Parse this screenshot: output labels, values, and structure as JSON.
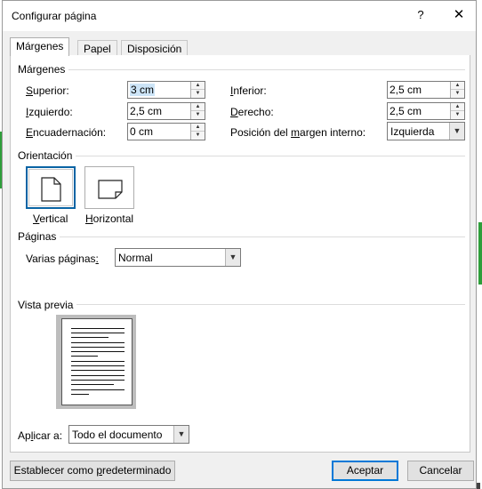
{
  "window": {
    "title": "Configurar página",
    "help_label": "?",
    "close_label": "✕"
  },
  "tabs": [
    {
      "label": "Márgenes",
      "active": true
    },
    {
      "label": "Papel",
      "active": false
    },
    {
      "label": "Disposición",
      "active": false
    }
  ],
  "margins": {
    "group_label": "Márgenes",
    "superior": {
      "label_pre": "",
      "label_u": "S",
      "label_post": "uperior:",
      "value": "3 cm"
    },
    "inferior": {
      "label_pre": "",
      "label_u": "I",
      "label_post": "nferior:",
      "value": "2,5 cm"
    },
    "izquierdo": {
      "label_pre": "",
      "label_u": "I",
      "label_post": "zquierdo:",
      "value": "2,5 cm"
    },
    "derecho": {
      "label_pre": "",
      "label_u": "D",
      "label_post": "erecho:",
      "value": "2,5 cm"
    },
    "encuadernacion": {
      "label_pre": "",
      "label_u": "E",
      "label_post": "ncuadernación:",
      "value": "0 cm"
    },
    "posicion": {
      "label_pre": "Posición del ",
      "label_u": "m",
      "label_post": "argen interno:",
      "value": "Izquierda"
    }
  },
  "orientation": {
    "group_label": "Orientación",
    "vertical": {
      "label_u": "V",
      "label_post": "ertical",
      "selected": true
    },
    "horizontal": {
      "label_u": "H",
      "label_post": "orizontal",
      "selected": false
    }
  },
  "pages": {
    "group_label": "Páginas",
    "multiple_label_pre": "Varias páginas",
    "multiple_label_u": ":",
    "multiple_value": "Normal"
  },
  "preview": {
    "group_label": "Vista previa"
  },
  "apply": {
    "label_pre": "Ap",
    "label_u": "l",
    "label_post": "icar a:",
    "value": "Todo el documento"
  },
  "footer": {
    "default_pre": "Establecer como ",
    "default_u": "p",
    "default_post": "redeterminado",
    "ok_label": "Aceptar",
    "cancel_label": "Cancelar"
  },
  "colors": {
    "accent": "#0078d7",
    "selection": "#cce4f7",
    "dialog_bg": "#f0f0f0"
  }
}
